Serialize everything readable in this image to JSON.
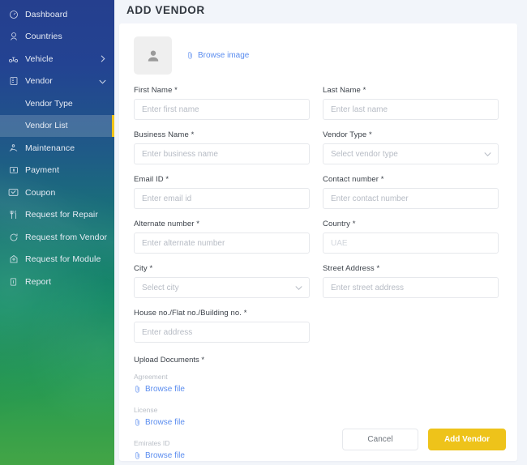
{
  "sidebar": {
    "items": [
      {
        "label": "Dashboard",
        "icon": "dashboard-icon",
        "expandable": false
      },
      {
        "label": "Countries",
        "icon": "globe-icon",
        "expandable": false
      },
      {
        "label": "Vehicle",
        "icon": "vehicle-icon",
        "expandable": true,
        "chevron": "chevron-right"
      },
      {
        "label": "Vendor",
        "icon": "vendor-icon",
        "expandable": true,
        "chevron": "chevron-down"
      }
    ],
    "vendor_children": [
      {
        "label": "Vendor Type",
        "active": false
      },
      {
        "label": "Vendor List",
        "active": true
      }
    ],
    "items_after": [
      {
        "label": "Maintenance",
        "icon": "maintenance-icon"
      },
      {
        "label": "Payment",
        "icon": "payment-icon"
      },
      {
        "label": "Coupon",
        "icon": "coupon-icon"
      },
      {
        "label": "Request for Repair",
        "icon": "repair-icon"
      },
      {
        "label": "Request from Vendor",
        "icon": "request-vendor-icon"
      },
      {
        "label": "Request for Module",
        "icon": "module-icon"
      },
      {
        "label": "Report",
        "icon": "report-icon"
      }
    ],
    "active_accent_color": "#f0c419"
  },
  "header": {
    "title": "ADD VENDOR"
  },
  "image_upload": {
    "browse_label": "Browse image",
    "icon": "paperclip-icon",
    "avatar_icon": "user-avatar-icon"
  },
  "form": {
    "fields": [
      {
        "label": "First Name *",
        "placeholder": "Enter first name",
        "type": "text",
        "name": "first-name"
      },
      {
        "label": "Last Name *",
        "placeholder": "Enter last name",
        "type": "text",
        "name": "last-name"
      },
      {
        "label": "Business Name *",
        "placeholder": "Enter business name",
        "type": "text",
        "name": "business-name"
      },
      {
        "label": "Vendor Type *",
        "placeholder": "Select vendor type",
        "type": "select",
        "name": "vendor-type"
      },
      {
        "label": "Email ID *",
        "placeholder": "Enter email id",
        "type": "text",
        "name": "email-id"
      },
      {
        "label": "Contact number *",
        "placeholder": "Enter contact number",
        "type": "text",
        "name": "contact-number"
      },
      {
        "label": "Alternate number *",
        "placeholder": "Enter alternate number",
        "type": "text",
        "name": "alternate-number"
      },
      {
        "label": "Country *",
        "placeholder": "UAE",
        "type": "disabled",
        "name": "country"
      },
      {
        "label": "City *",
        "placeholder": "Select city",
        "type": "select",
        "name": "city"
      },
      {
        "label": "Street Address *",
        "placeholder": "Enter street address",
        "type": "text",
        "name": "street-address"
      },
      {
        "label": "House no./Flat no./Building no. *",
        "placeholder": "Enter address",
        "type": "text",
        "name": "house-no"
      }
    ]
  },
  "uploads": {
    "title": "Upload Documents *",
    "items": [
      {
        "name": "Agreement",
        "link": "Browse file"
      },
      {
        "name": "License",
        "link": "Browse file"
      },
      {
        "name": "Emirates ID",
        "link": "Browse file"
      }
    ]
  },
  "footer": {
    "cancel_label": "Cancel",
    "submit_label": "Add Vendor",
    "submit_color": "#eec31a"
  }
}
